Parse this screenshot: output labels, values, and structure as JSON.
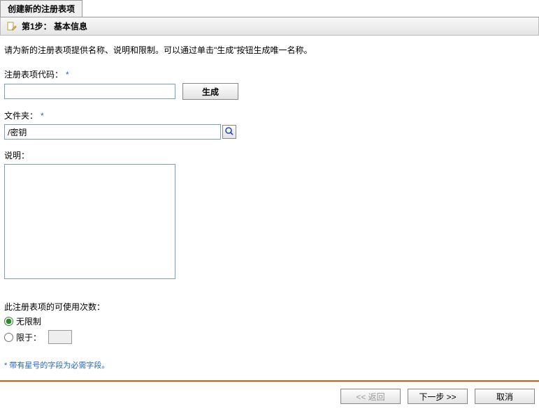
{
  "tab": {
    "title": "创建新的注册表项"
  },
  "step": {
    "title": "第1步：  基本信息"
  },
  "intro": "请为新的注册表项提供名称、说明和限制。可以通过单击\"生成\"按钮生成唯一名称。",
  "code": {
    "label": "注册表项代码：",
    "value": "",
    "generate_btn": "生成"
  },
  "folder": {
    "label": "文件夹：",
    "value": "/密钥"
  },
  "desc": {
    "label": "说明：",
    "value": ""
  },
  "usage": {
    "label": "此注册表项的可使用次数：",
    "unlimited": "无限制",
    "limited": "限于：",
    "limited_value": ""
  },
  "footnote": "* 带有星号的字段为必需字段。",
  "buttons": {
    "back": "<<  返回",
    "next": "下一步  >>",
    "cancel": "取消"
  }
}
